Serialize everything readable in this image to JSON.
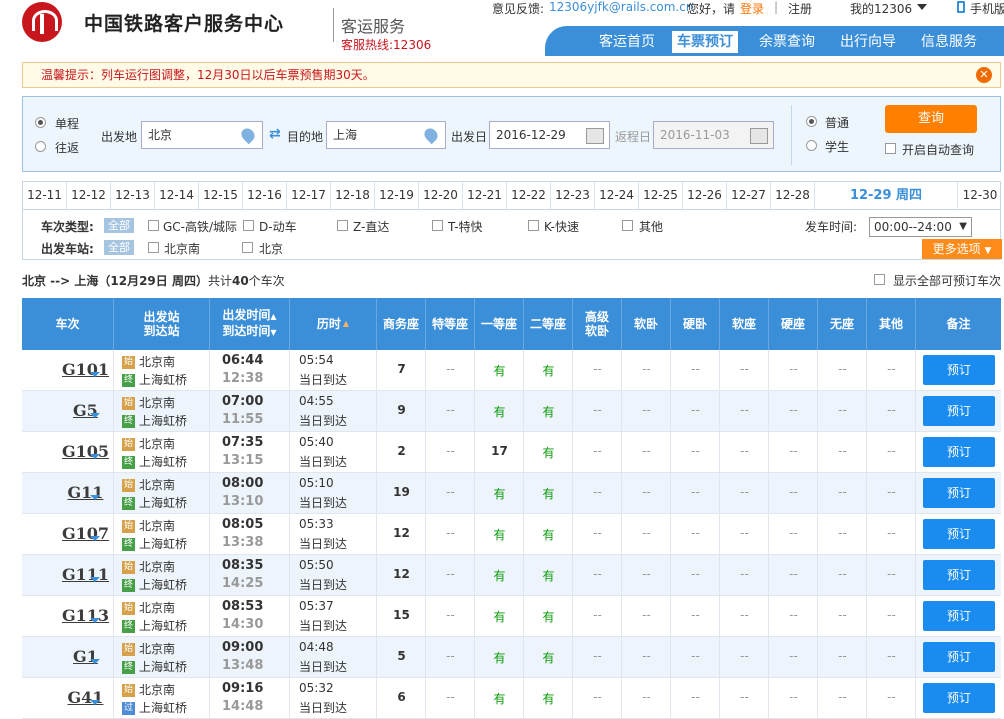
{
  "header": {
    "site_name": "中国铁路客户服务中心",
    "sub_title": "客运服务",
    "hotline": "客服热线:12306",
    "feedback_label": "意见反馈:",
    "feedback_email": "12306yjfk@rails.com.cn",
    "greeting": "您好，请",
    "login": "登录",
    "register": "注册",
    "my12306": "我的12306",
    "mobile": "手机版",
    "sep": "|"
  },
  "nav": [
    "客运首页",
    "车票预订",
    "余票查询",
    "出行向导",
    "信息服务"
  ],
  "nav_active": 1,
  "tip": {
    "text": "温馨提示：列车运行图调整，12月30日以后车票预售期30天。"
  },
  "query": {
    "oneway": "单程",
    "roundtrip": "往返",
    "from_label": "出发地",
    "from_value": "北京",
    "to_label": "目的地",
    "to_value": "上海",
    "depart_label": "出发日",
    "depart_value": "2016-12-29",
    "return_label": "返程日",
    "return_value": "2016-11-03",
    "normal": "普通",
    "student": "学生",
    "search_button": "查询",
    "auto_query": "开启自动查询"
  },
  "dates": [
    "12-11",
    "12-12",
    "12-13",
    "12-14",
    "12-15",
    "12-16",
    "12-17",
    "12-18",
    "12-19",
    "12-20",
    "12-21",
    "12-22",
    "12-23",
    "12-24",
    "12-25",
    "12-26",
    "12-27",
    "12-28",
    "12-29 周四",
    "12-30"
  ],
  "filters": {
    "type_label": "车次类型:",
    "all": "全部",
    "types": [
      "GC-高铁/城际",
      "D-动车",
      "Z-直达",
      "T-特快",
      "K-快速",
      "其他"
    ],
    "station_label": "出发车站:",
    "stations": [
      "北京南",
      "北京"
    ],
    "time_label": "发车时间:",
    "time_value": "00:00--24:00",
    "more": "更多选项"
  },
  "summary": {
    "route": "北京 --> 上海（12月29日 周四）",
    "count_prefix": "共计",
    "count": "40",
    "count_suffix": "个车次",
    "show_all": "显示全部可预订车次"
  },
  "columns": {
    "train": "车次",
    "station1": "出发站",
    "station2": "到达站",
    "time1": "出发时间",
    "time2": "到达时间",
    "duration": "历时",
    "business": "商务座",
    "special": "特等座",
    "first": "一等座",
    "second": "二等座",
    "soft_sleeper_high1": "高级",
    "soft_sleeper_high2": "软卧",
    "soft_sleeper": "软卧",
    "hard_sleeper": "硬卧",
    "soft_seat": "软座",
    "hard_seat": "硬座",
    "no_seat": "无座",
    "other": "其他",
    "remark": "备注"
  },
  "badges": {
    "start": "始",
    "end": "终",
    "pass": "过"
  },
  "book_label": "预订",
  "trains": [
    {
      "no": "G101",
      "from": "北京南",
      "to": "上海虹桥",
      "dep": "06:44",
      "arr": "12:38",
      "dur": "05:54",
      "note": "当日到达",
      "biz": "7",
      "first": "有",
      "second": "有",
      "from_badge": "start"
    },
    {
      "no": "G5",
      "from": "北京南",
      "to": "上海虹桥",
      "dep": "07:00",
      "arr": "11:55",
      "dur": "04:55",
      "note": "当日到达",
      "biz": "9",
      "first": "有",
      "second": "有",
      "from_badge": "start"
    },
    {
      "no": "G105",
      "from": "北京南",
      "to": "上海虹桥",
      "dep": "07:35",
      "arr": "13:15",
      "dur": "05:40",
      "note": "当日到达",
      "biz": "2",
      "first": "17",
      "second": "有",
      "from_badge": "start"
    },
    {
      "no": "G11",
      "from": "北京南",
      "to": "上海虹桥",
      "dep": "08:00",
      "arr": "13:10",
      "dur": "05:10",
      "note": "当日到达",
      "biz": "19",
      "first": "有",
      "second": "有",
      "from_badge": "start"
    },
    {
      "no": "G107",
      "from": "北京南",
      "to": "上海虹桥",
      "dep": "08:05",
      "arr": "13:38",
      "dur": "05:33",
      "note": "当日到达",
      "biz": "12",
      "first": "有",
      "second": "有",
      "from_badge": "start"
    },
    {
      "no": "G111",
      "from": "北京南",
      "to": "上海虹桥",
      "dep": "08:35",
      "arr": "14:25",
      "dur": "05:50",
      "note": "当日到达",
      "biz": "12",
      "first": "有",
      "second": "有",
      "from_badge": "start"
    },
    {
      "no": "G113",
      "from": "北京南",
      "to": "上海虹桥",
      "dep": "08:53",
      "arr": "14:30",
      "dur": "05:37",
      "note": "当日到达",
      "biz": "15",
      "first": "有",
      "second": "有",
      "from_badge": "start"
    },
    {
      "no": "G1",
      "from": "北京南",
      "to": "上海虹桥",
      "dep": "09:00",
      "arr": "13:48",
      "dur": "04:48",
      "note": "当日到达",
      "biz": "5",
      "first": "有",
      "second": "有",
      "from_badge": "start"
    },
    {
      "no": "G41",
      "from": "北京南",
      "to": "上海虹桥",
      "dep": "09:16",
      "arr": "14:48",
      "dur": "05:32",
      "note": "当日到达",
      "biz": "6",
      "first": "有",
      "second": "有",
      "from_badge": "start",
      "to_badge": "pass"
    }
  ],
  "empty": "--"
}
